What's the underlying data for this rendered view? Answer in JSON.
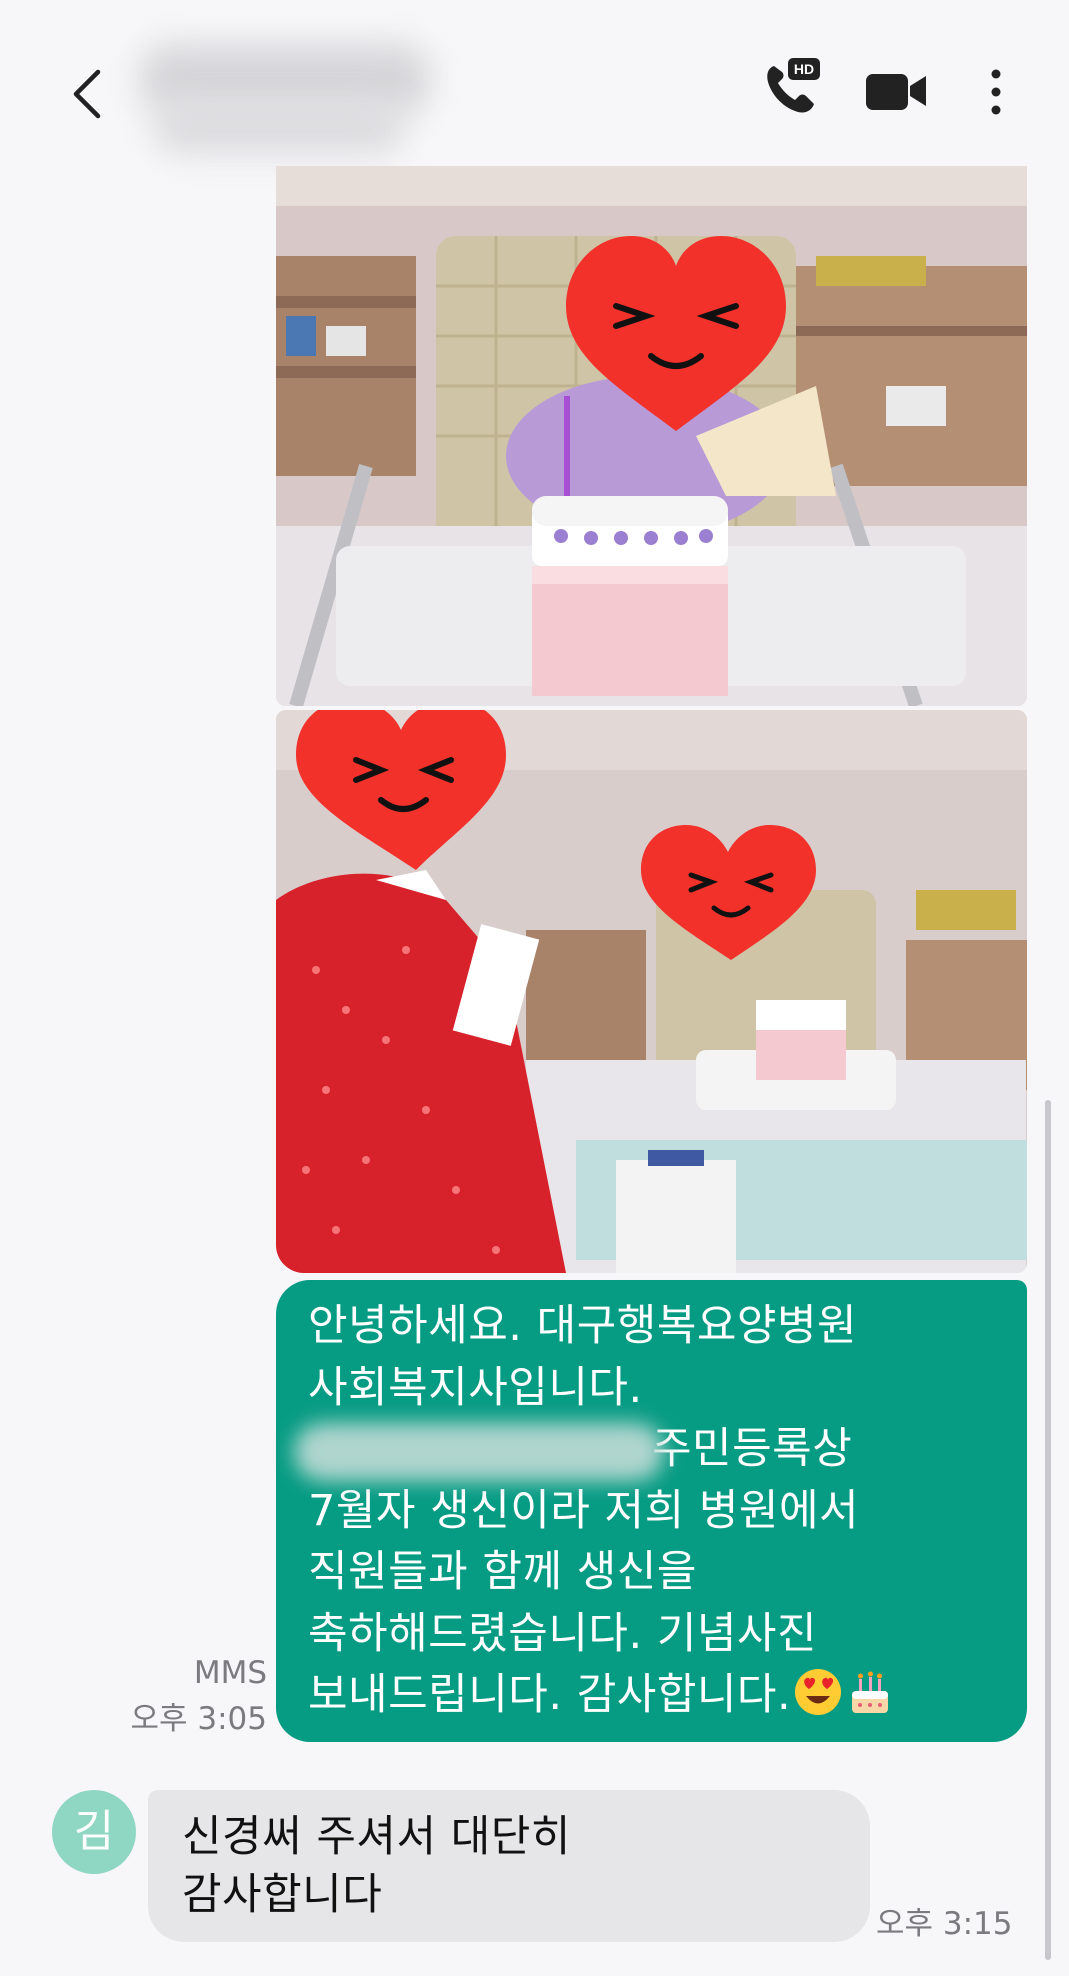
{
  "header": {
    "contact_name": "",
    "icons": {
      "back": "chevron-left-icon",
      "hd_call": "hd-voice-call-icon",
      "video_call": "video-camera-icon",
      "more": "more-vertical-icon"
    },
    "hd_badge": "HD"
  },
  "messages": {
    "outgoing": {
      "photos": [
        "hospital-birthday-photo-1",
        "hospital-birthday-photo-2"
      ],
      "text_lines": [
        "안녕하세요. 대구행복요양병원",
        "사회복지사입니다.",
        "주민등록상",
        "7월자 생신이라 저희 병원에서",
        "직원들과 함께 생신을",
        "축하해드렸습니다. 기념사진",
        "보내드립니다. 감사합니다."
      ],
      "emojis": [
        "heart-eyes-emoji",
        "birthday-cake-emoji"
      ],
      "type_label": "MMS",
      "time": "오후 3:05"
    },
    "incoming": {
      "avatar_initial": "김",
      "text_lines": [
        "신경써 주셔서 대단히",
        "감사합니다"
      ],
      "time": "오후 3:15"
    }
  },
  "colors": {
    "outgoing_bubble": "#069b83",
    "incoming_bubble": "#e6e6e8",
    "avatar": "#8fd7c2",
    "background": "#f7f7f9"
  }
}
